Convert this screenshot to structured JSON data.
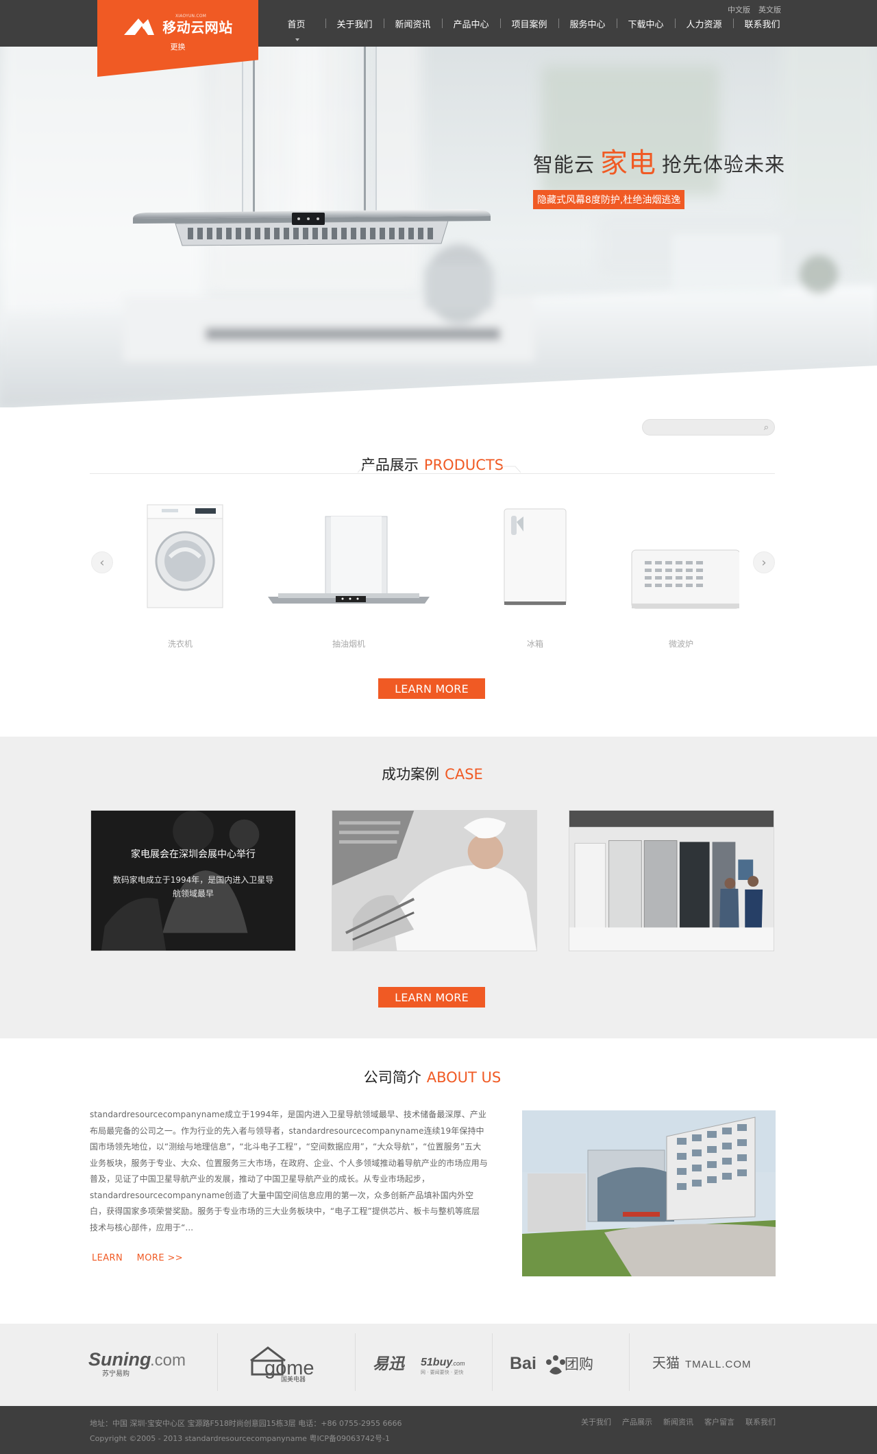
{
  "header": {
    "logo_text": "移动云网站",
    "logo_domain": "XIAOYUN.COM",
    "logo_sub": "更换",
    "nav": [
      "首页",
      "关于我们",
      "新闻资讯",
      "产品中心",
      "项目案例",
      "服务中心",
      "下载中心",
      "人力资源",
      "联系我们"
    ],
    "lang": [
      "中文版",
      "英文版"
    ]
  },
  "hero": {
    "title_prefix": "智能云",
    "title_accent": "家电",
    "title_suffix": "抢先体验未来",
    "tagline": "隐藏式风幕8度防护,杜绝油烟逃逸"
  },
  "search": {
    "placeholder": ""
  },
  "products": {
    "title_cn": "产品展示",
    "title_en": "PRODUCTS",
    "items": [
      {
        "name": "洗衣机",
        "icon": "washing-machine-icon"
      },
      {
        "name": "抽油烟机",
        "icon": "range-hood-icon"
      },
      {
        "name": "冰箱",
        "icon": "refrigerator-icon"
      },
      {
        "name": "微波炉",
        "icon": "microwave-icon"
      }
    ],
    "button": "LEARN MORE"
  },
  "case": {
    "title_cn": "成功案例",
    "title_en": "CASE",
    "overlay_title": "家电展会在深圳会展中心举行",
    "overlay_desc": "数码家电成立于1994年，是国内进入卫星导航领域最早",
    "button": "LEARN MORE"
  },
  "about": {
    "title_cn": "公司简介",
    "title_en": "ABOUT US",
    "text": "standardresourcecompanyname成立于1994年，是国内进入卫星导航领域最早、技术储备最深厚、产业布局最完备的公司之一。作为行业的先入者与领导者，standardresourcecompanyname连续19年保持中国市场领先地位，以“测绘与地理信息”，“北斗电子工程”，“空间数据应用”，“大众导航”，“位置服务”五大业务板块，服务于专业、大众、位置服务三大市场，在政府、企业、个人多领域推动着导航产业的市场应用与普及，见证了中国卫星导航产业的发展，推动了中国卫星导航产业的成长。从专业市场起步，standardresourcecompanyname创造了大量中国空间信息应用的第一次，众多创新产品填补国内外空白，获得国家多项荣誉奖励。服务于专业市场的三大业务板块中，“电子工程”提供芯片、板卡与整机等底层技术与核心部件，应用于“...",
    "link_learn": "LEARN",
    "link_more": "MORE >>"
  },
  "partners": [
    {
      "name": "Suning.com",
      "sub": "苏宁易购"
    },
    {
      "name": "gome",
      "sub": "国美电器"
    },
    {
      "name": "易迅 51buy.com",
      "sub": "网 · 要闻要快 · 更快"
    },
    {
      "name": "Baidu 团购",
      "sub": ""
    },
    {
      "name": "天猫 TMALL.COM",
      "sub": ""
    }
  ],
  "footer": {
    "address": "地址：中国 深圳·宝安中心区 宝源路F518时尚创意园15栋3层  电话：+86 0755-2955 6666",
    "copyright": "Copyright ©2005 - 2013 standardresourcecompanyname 粤ICP备09063742号-1",
    "links": [
      "关于我们",
      "产品展示",
      "新闻资讯",
      "客户留言",
      "联系我们"
    ]
  },
  "colors": {
    "accent": "#f05a24",
    "header": "#3f3f3f",
    "footer": "#3e3e3e",
    "light_bg": "#efefef"
  }
}
